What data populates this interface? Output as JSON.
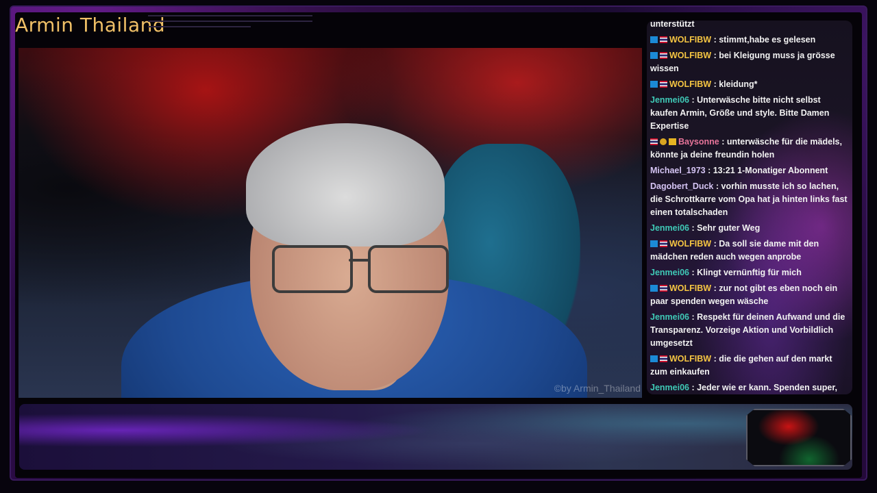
{
  "stream": {
    "title": "Armin Thailand",
    "watermark": "©by Armin_Thailand"
  },
  "chat": {
    "top_partial": "unterstützt",
    "messages": [
      {
        "badges": [
          "blue",
          "flag"
        ],
        "user": "WOLFIBW",
        "sep": " : ",
        "text": "stimmt,habe es gelesen",
        "color": "wolf"
      },
      {
        "badges": [
          "blue",
          "flag"
        ],
        "user": "WOLFIBW",
        "sep": " : ",
        "text": "bei Kleigung muss ja grösse wissen",
        "color": "wolf"
      },
      {
        "badges": [
          "blue",
          "flag"
        ],
        "user": "WOLFIBW",
        "sep": " : ",
        "text": "kleidung*",
        "color": "wolf"
      },
      {
        "badges": [],
        "user": "Jenmei06",
        "sep": " : ",
        "text": "Unterwäsche bitte nicht selbst kaufen Armin, Größe und style. Bitte Damen Expertise",
        "color": "jen"
      },
      {
        "badges": [
          "flag",
          "gold",
          "crown"
        ],
        "user": "Baysonne",
        "sep": " : ",
        "text": "unterwäsche für die mädels, könnte ja deine freundin holen",
        "color": "bay"
      },
      {
        "badges": [],
        "user": "Michael_1973",
        "sep": " : ",
        "text": "13:21 1-Monatiger Abonnent",
        "color": "mic"
      },
      {
        "badges": [],
        "user": "Dagobert_Duck",
        "sep": " : ",
        "text": "vorhin musste ich so lachen, die Schrottkarre vom Opa hat ja hinten links fast einen totalschaden",
        "color": "mic"
      },
      {
        "badges": [],
        "user": "Jenmei06",
        "sep": " : ",
        "text": "Sehr guter Weg",
        "color": "jen"
      },
      {
        "badges": [
          "blue",
          "flag"
        ],
        "user": "WOLFIBW",
        "sep": " : ",
        "text": "Da soll sie dame mit den mädchen reden auch wegen anprobe",
        "color": "wolf"
      },
      {
        "badges": [],
        "user": "Jenmei06",
        "sep": " : ",
        "text": "Klingt vernünftig für mich",
        "color": "jen"
      },
      {
        "badges": [
          "blue",
          "flag"
        ],
        "user": "WOLFIBW",
        "sep": " : ",
        "text": "zur not gibt es eben noch ein paar spenden wegen wäsche",
        "color": "wolf"
      },
      {
        "badges": [],
        "user": "Jenmei06",
        "sep": " : ",
        "text": "Respekt für deinen Aufwand und die Transparenz. Vorzeige Aktion und Vorbildlich umgesetzt",
        "color": "jen"
      },
      {
        "badges": [
          "blue",
          "flag"
        ],
        "user": "WOLFIBW",
        "sep": " : ",
        "text": "die die gehen auf den markt zum einkaufen",
        "color": "wolf"
      },
      {
        "badges": [],
        "user": "Jenmei06",
        "sep": " : ",
        "text": "Jeder wie er kann. Spenden super, Umsetzung super, Teamarbeit für die Kinder",
        "color": "jen"
      }
    ]
  }
}
